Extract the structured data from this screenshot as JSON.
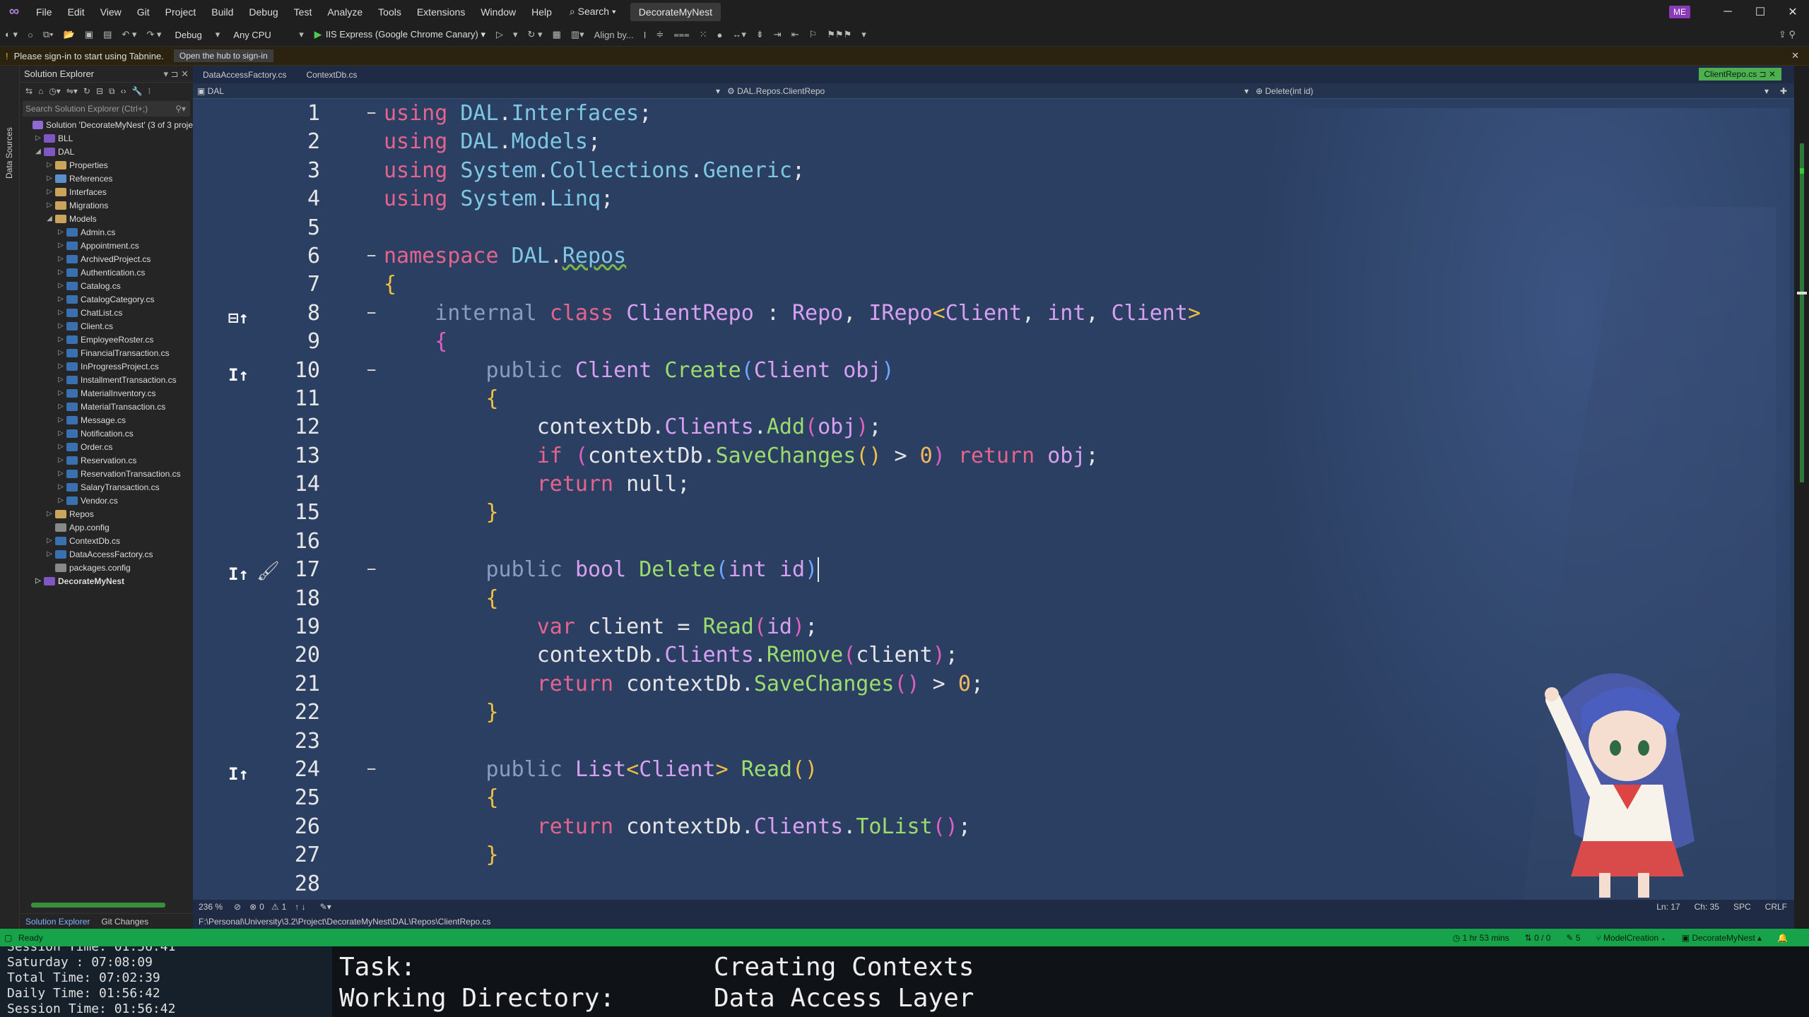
{
  "menubar": {
    "items": [
      "File",
      "Edit",
      "View",
      "Git",
      "Project",
      "Build",
      "Debug",
      "Test",
      "Analyze",
      "Tools",
      "Extensions",
      "Window",
      "Help"
    ],
    "search": "Search",
    "solution_name": "DecorateMyNest",
    "user_badge": "ME"
  },
  "toolbar": {
    "config": "Debug",
    "platform": "Any CPU",
    "run_target": "IIS Express (Google Chrome Canary)",
    "align_label": "Align by..."
  },
  "infobar": {
    "message": "Please sign-in to start using Tabnine.",
    "button": "Open the hub to sign-in"
  },
  "left_strip_label": "Data Sources",
  "solution_explorer": {
    "title": "Solution Explorer",
    "search_placeholder": "Search Solution Explorer (Ctrl+;)",
    "tree": [
      {
        "label": "Solution 'DecorateMyNest' (3 of 3 proje",
        "indent": 0,
        "icon": "sol",
        "arrow": ""
      },
      {
        "label": "BLL",
        "indent": 1,
        "icon": "proj",
        "arrow": "▷"
      },
      {
        "label": "DAL",
        "indent": 1,
        "icon": "proj",
        "arrow": "◢"
      },
      {
        "label": "Properties",
        "indent": 2,
        "icon": "fld",
        "arrow": "▷"
      },
      {
        "label": "References",
        "indent": 2,
        "icon": "ref",
        "arrow": "▷"
      },
      {
        "label": "Interfaces",
        "indent": 2,
        "icon": "fld",
        "arrow": "▷"
      },
      {
        "label": "Migrations",
        "indent": 2,
        "icon": "fld",
        "arrow": "▷"
      },
      {
        "label": "Models",
        "indent": 2,
        "icon": "fld",
        "arrow": "◢"
      },
      {
        "label": "Admin.cs",
        "indent": 3,
        "icon": "cs",
        "arrow": "▷"
      },
      {
        "label": "Appointment.cs",
        "indent": 3,
        "icon": "cs",
        "arrow": "▷"
      },
      {
        "label": "ArchivedProject.cs",
        "indent": 3,
        "icon": "cs",
        "arrow": "▷"
      },
      {
        "label": "Authentication.cs",
        "indent": 3,
        "icon": "cs",
        "arrow": "▷"
      },
      {
        "label": "Catalog.cs",
        "indent": 3,
        "icon": "cs",
        "arrow": "▷"
      },
      {
        "label": "CatalogCategory.cs",
        "indent": 3,
        "icon": "cs",
        "arrow": "▷"
      },
      {
        "label": "ChatList.cs",
        "indent": 3,
        "icon": "cs",
        "arrow": "▷"
      },
      {
        "label": "Client.cs",
        "indent": 3,
        "icon": "cs",
        "arrow": "▷"
      },
      {
        "label": "EmployeeRoster.cs",
        "indent": 3,
        "icon": "cs",
        "arrow": "▷"
      },
      {
        "label": "FinancialTransaction.cs",
        "indent": 3,
        "icon": "cs",
        "arrow": "▷"
      },
      {
        "label": "InProgressProject.cs",
        "indent": 3,
        "icon": "cs",
        "arrow": "▷"
      },
      {
        "label": "InstallmentTransaction.cs",
        "indent": 3,
        "icon": "cs",
        "arrow": "▷"
      },
      {
        "label": "MaterialInventory.cs",
        "indent": 3,
        "icon": "cs",
        "arrow": "▷"
      },
      {
        "label": "MaterialTransaction.cs",
        "indent": 3,
        "icon": "cs",
        "arrow": "▷"
      },
      {
        "label": "Message.cs",
        "indent": 3,
        "icon": "cs",
        "arrow": "▷"
      },
      {
        "label": "Notification.cs",
        "indent": 3,
        "icon": "cs",
        "arrow": "▷"
      },
      {
        "label": "Order.cs",
        "indent": 3,
        "icon": "cs",
        "arrow": "▷"
      },
      {
        "label": "Reservation.cs",
        "indent": 3,
        "icon": "cs",
        "arrow": "▷"
      },
      {
        "label": "ReservationTransaction.cs",
        "indent": 3,
        "icon": "cs",
        "arrow": "▷"
      },
      {
        "label": "SalaryTransaction.cs",
        "indent": 3,
        "icon": "cs",
        "arrow": "▷"
      },
      {
        "label": "Vendor.cs",
        "indent": 3,
        "icon": "cs",
        "arrow": "▷"
      },
      {
        "label": "Repos",
        "indent": 2,
        "icon": "fld",
        "arrow": "▷"
      },
      {
        "label": "App.config",
        "indent": 2,
        "icon": "cfg",
        "arrow": ""
      },
      {
        "label": "ContextDb.cs",
        "indent": 2,
        "icon": "cs",
        "arrow": "▷"
      },
      {
        "label": "DataAccessFactory.cs",
        "indent": 2,
        "icon": "cs",
        "arrow": "▷"
      },
      {
        "label": "packages.config",
        "indent": 2,
        "icon": "cfg",
        "arrow": ""
      },
      {
        "label": "DecorateMyNest",
        "indent": 1,
        "icon": "proj",
        "arrow": "▷",
        "bold": true
      }
    ],
    "bottom_tabs": [
      "Solution Explorer",
      "Git Changes"
    ]
  },
  "editor": {
    "tabs": [
      "DataAccessFactory.cs",
      "ContextDb.cs"
    ],
    "active_tab": "ClientRepo.cs",
    "nav_project": "DAL",
    "nav_class": "DAL.Repos.ClientRepo",
    "nav_member": "Delete(int id)",
    "zoom": "236 %",
    "errors": "0",
    "warnings": "1",
    "path": "F:\\Personal\\University\\3.2\\Project\\DecorateMyNest\\DAL\\Repos\\ClientRepo.cs",
    "ln": "Ln: 17",
    "ch": "Ch: 35",
    "spc": "SPC",
    "crlf": "CRLF"
  },
  "status": {
    "ready": "Ready",
    "time": "1 hr 53 mins",
    "git_counts": "0 / 0",
    "pencil": "5",
    "branch": "ModelCreation",
    "repo": "DecorateMyNest"
  },
  "terminal_left": {
    "lines": [
      "Session Time: 01:56:41",
      "Saturday  :  07:08:09",
      "Total Time: 07:02:39",
      "Daily Time: 01:56:42",
      "Session Time: 01:56:42"
    ]
  },
  "terminal_right": {
    "task_label": "Task:",
    "task_value": "Creating Contexts",
    "dir_label": "Working Directory:",
    "dir_value": "Data Access Layer"
  }
}
